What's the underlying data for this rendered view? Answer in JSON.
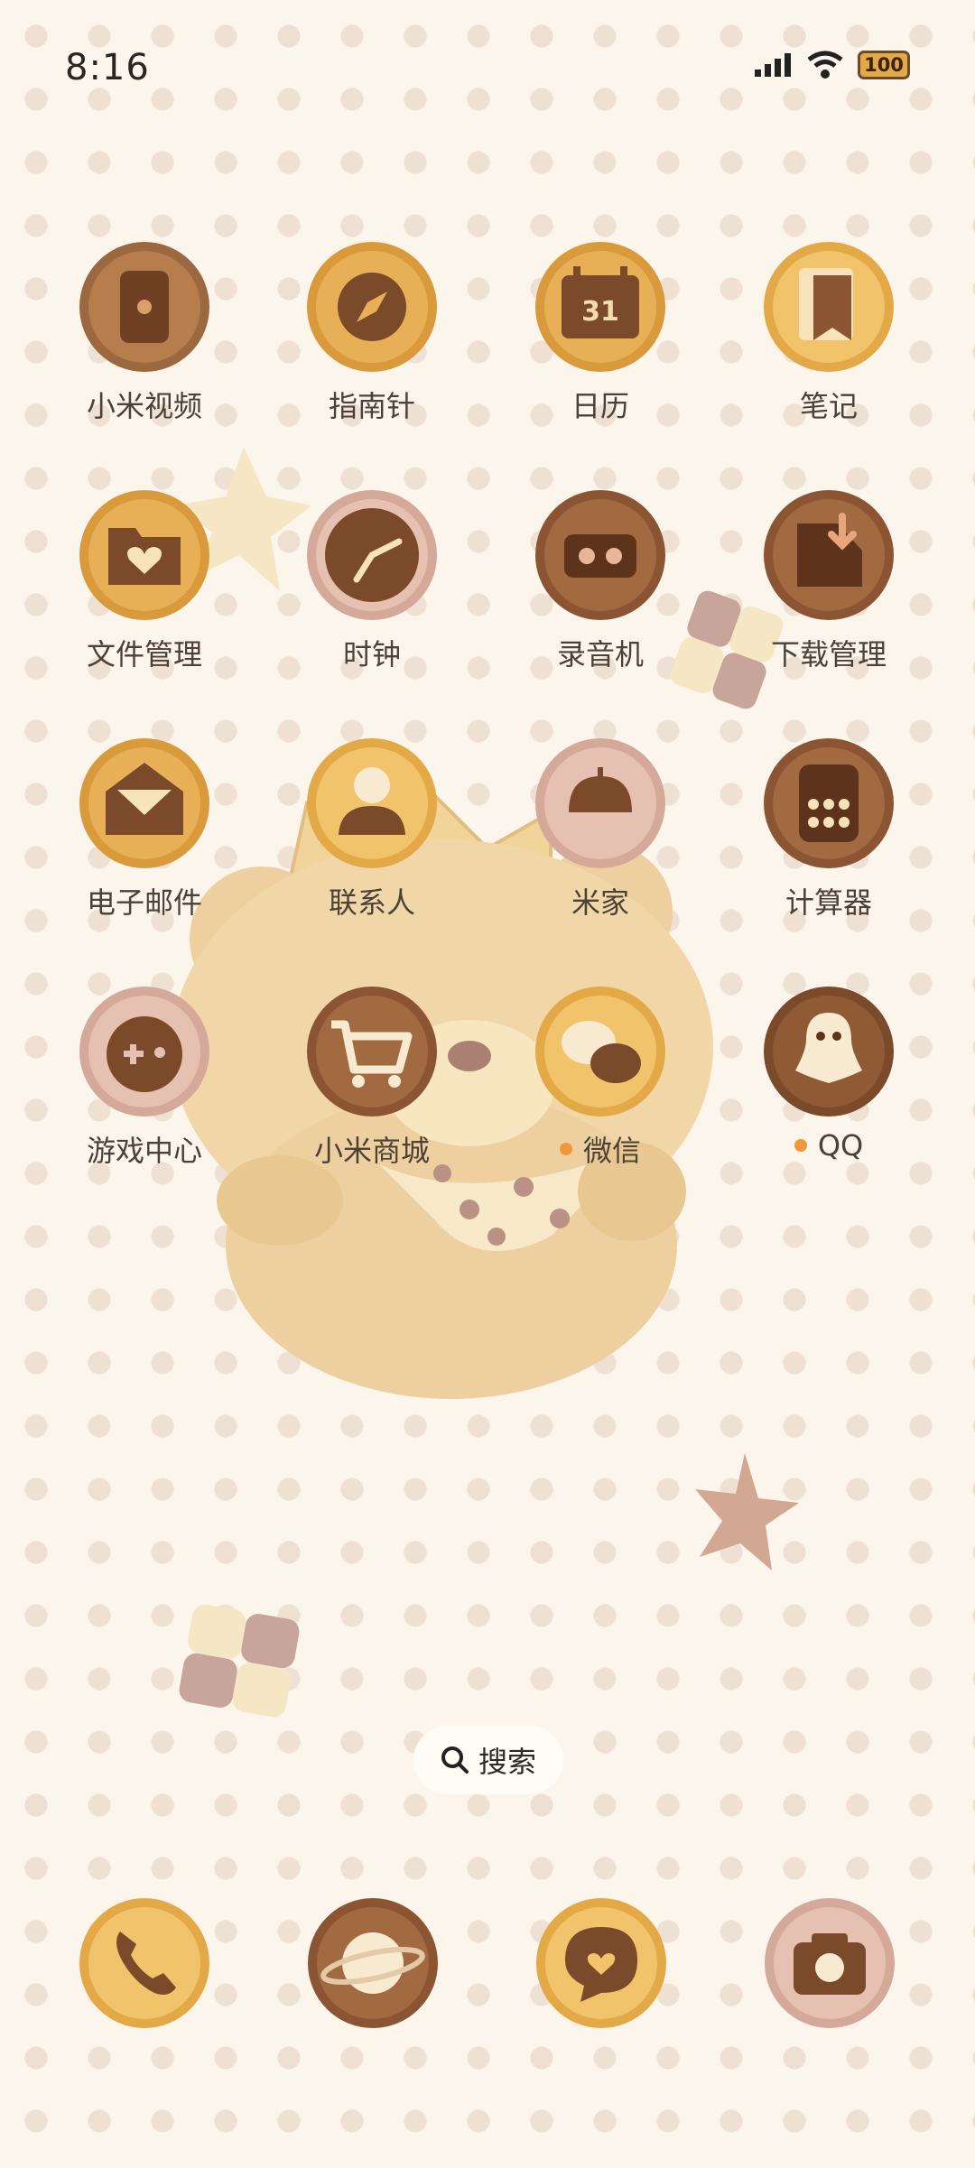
{
  "status_bar": {
    "time": "8:16",
    "battery": "100"
  },
  "apps": [
    {
      "label": "小米视频",
      "icon": "video-icon"
    },
    {
      "label": "指南针",
      "icon": "compass-icon"
    },
    {
      "label": "日历",
      "icon": "calendar-icon",
      "badge_text": "31"
    },
    {
      "label": "笔记",
      "icon": "notes-icon"
    },
    {
      "label": "文件管理",
      "icon": "folder-heart-icon"
    },
    {
      "label": "时钟",
      "icon": "clock-icon"
    },
    {
      "label": "录音机",
      "icon": "recorder-icon"
    },
    {
      "label": "下载管理",
      "icon": "download-icon"
    },
    {
      "label": "电子邮件",
      "icon": "envelope-icon"
    },
    {
      "label": "联系人",
      "icon": "contact-icon"
    },
    {
      "label": "米家",
      "icon": "smart-home-icon"
    },
    {
      "label": "计算器",
      "icon": "calculator-icon"
    },
    {
      "label": "游戏中心",
      "icon": "gamepad-icon"
    },
    {
      "label": "小米商城",
      "icon": "cart-icon"
    },
    {
      "label": "微信",
      "icon": "wechat-icon",
      "new": true
    },
    {
      "label": "QQ",
      "icon": "penguin-icon",
      "new": true
    }
  ],
  "search": {
    "label": "搜索"
  },
  "dock": [
    {
      "name": "phone",
      "icon": "phone-icon"
    },
    {
      "name": "browser",
      "icon": "planet-icon"
    },
    {
      "name": "messages",
      "icon": "message-heart-icon"
    },
    {
      "name": "camera",
      "icon": "camera-icon"
    }
  ],
  "colors": {
    "background": "#fbf5ec",
    "polka_dot": "#efe0d4",
    "cookie_golden": "#e8a94b",
    "cookie_dark": "#8b5533",
    "cookie_pink": "#d9b1a6",
    "label_text": "#4d4137",
    "notification_dot": "#f2953b"
  }
}
